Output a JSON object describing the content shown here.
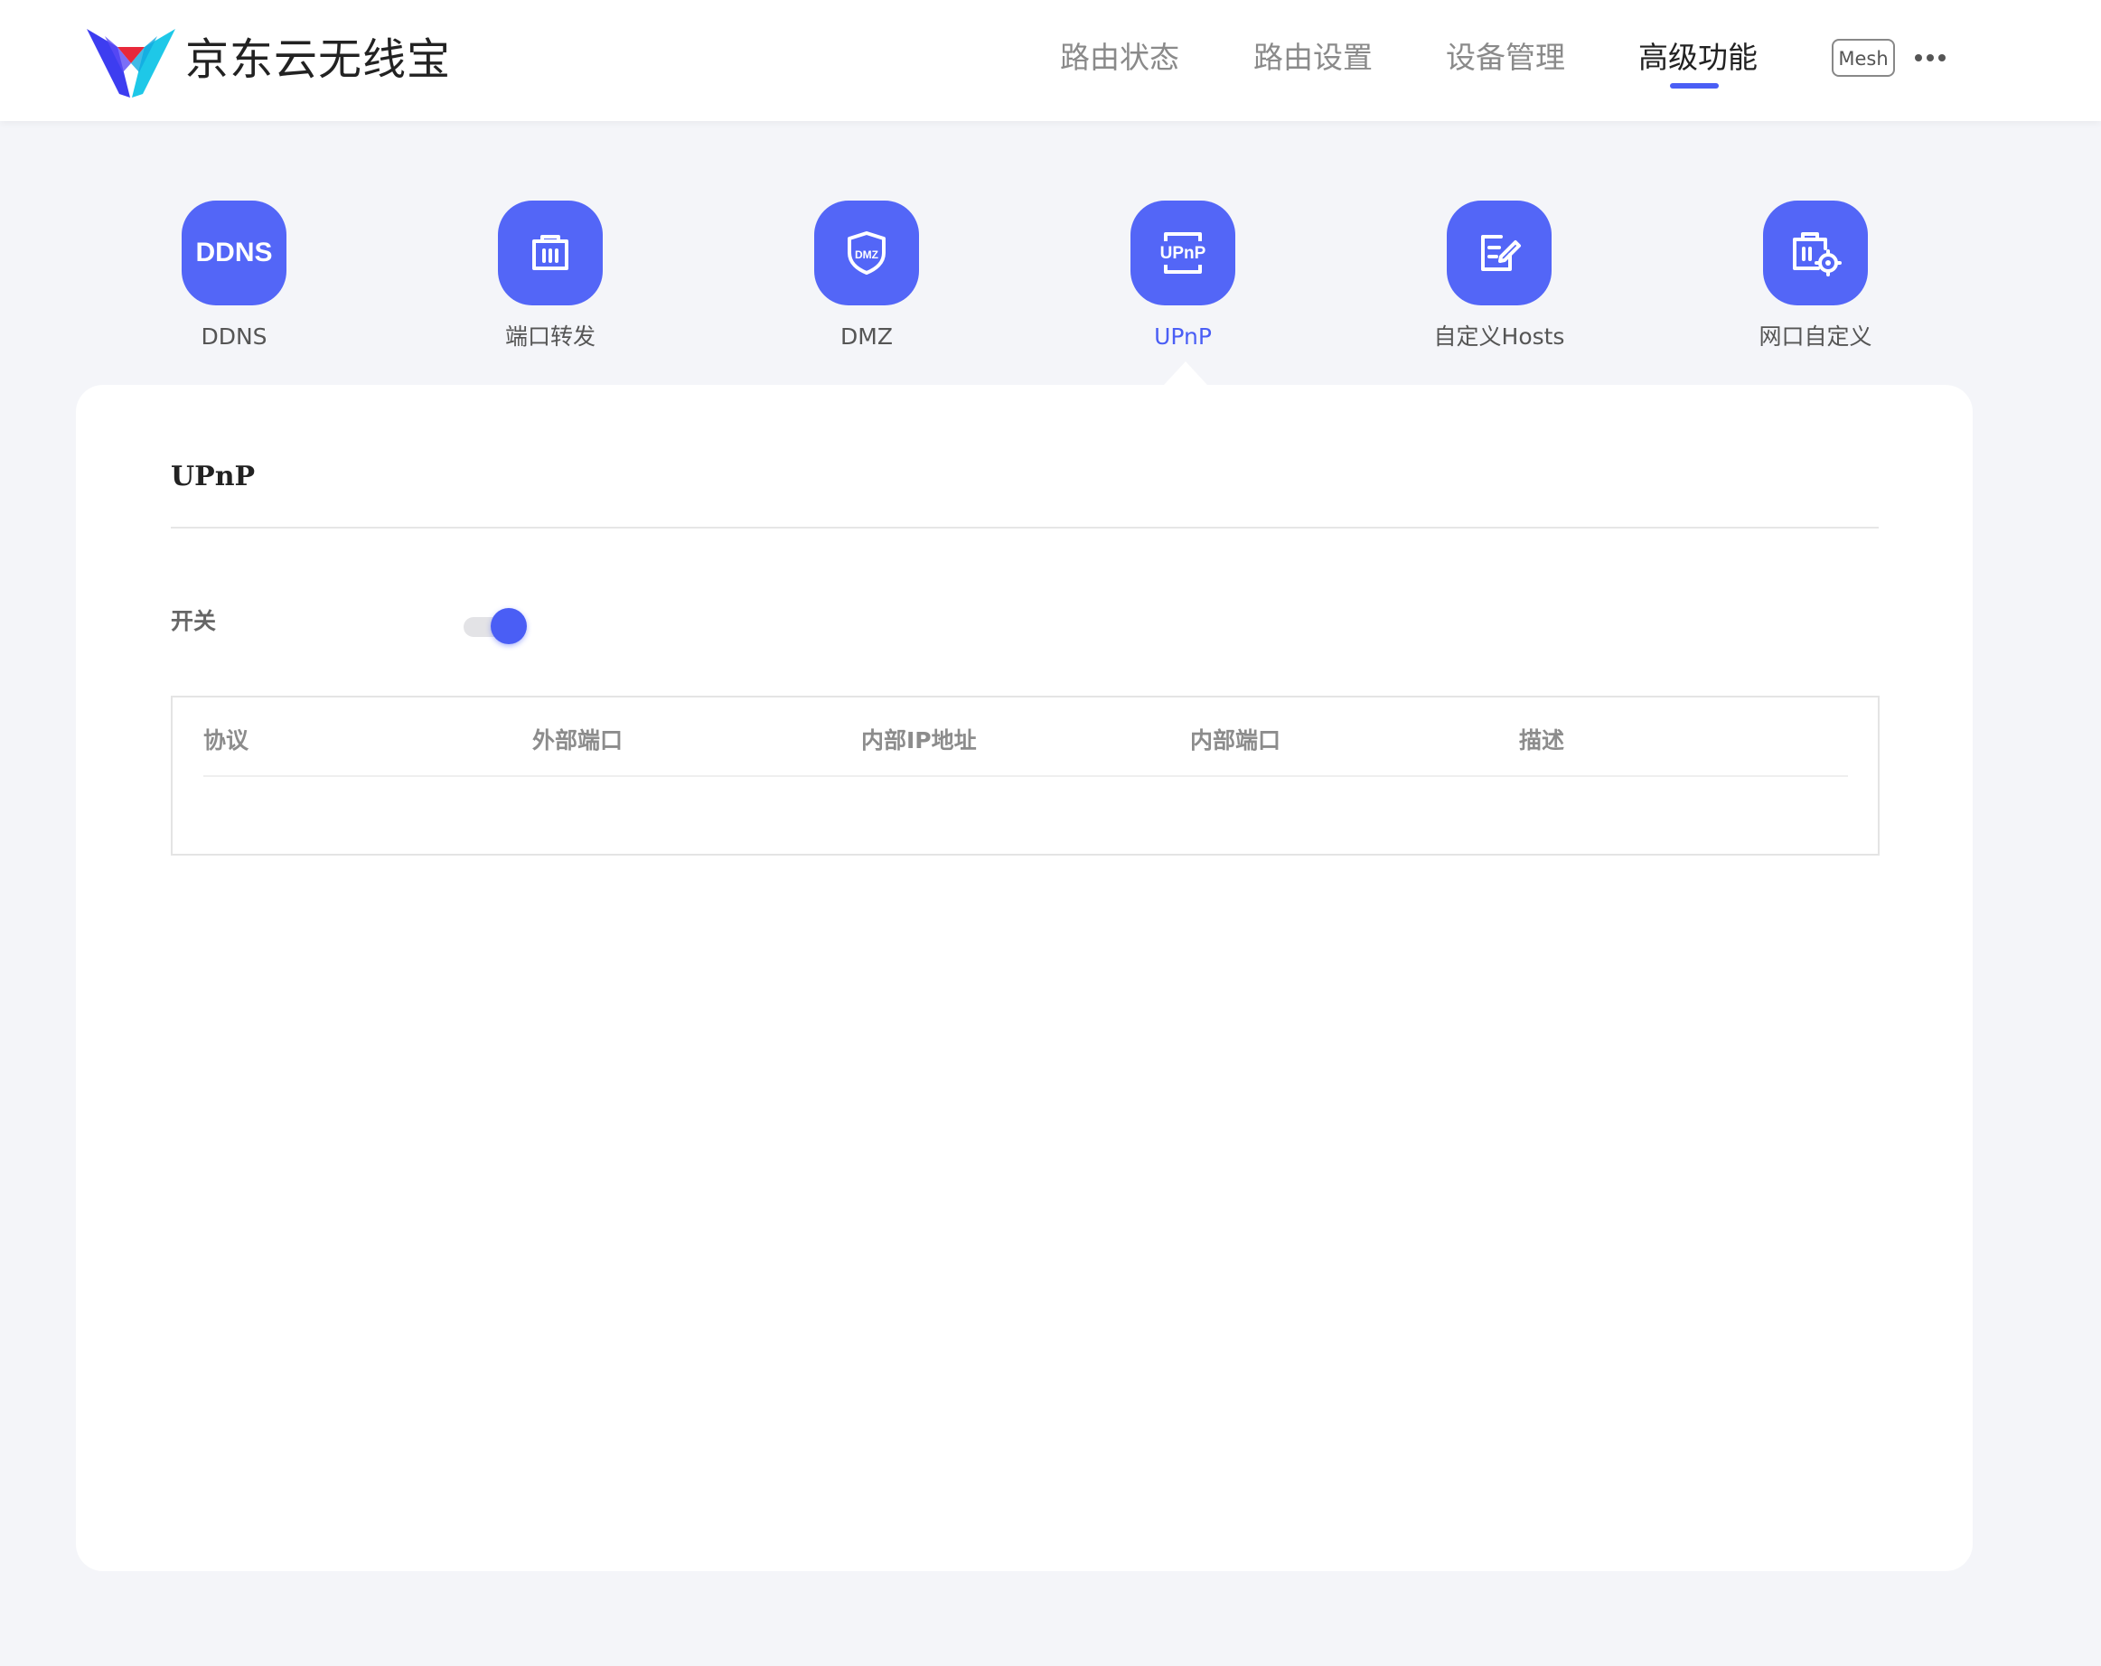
{
  "header": {
    "brand": "京东云无线宝",
    "nav": [
      {
        "label": "路由状态",
        "active": false
      },
      {
        "label": "路由设置",
        "active": false
      },
      {
        "label": "设备管理",
        "active": false
      },
      {
        "label": "高级功能",
        "active": true
      }
    ],
    "mesh_label": "Mesh",
    "more_icon": "ellipsis-icon"
  },
  "features": [
    {
      "label": "DDNS",
      "icon": "ddns-icon",
      "icon_text": "DDNS",
      "active": false
    },
    {
      "label": "端口转发",
      "icon": "port-forward-icon",
      "active": false
    },
    {
      "label": "DMZ",
      "icon": "dmz-shield-icon",
      "icon_text": "DMZ",
      "active": false
    },
    {
      "label": "UPnP",
      "icon": "upnp-icon",
      "icon_text": "UPnP",
      "active": true
    },
    {
      "label": "自定义Hosts",
      "icon": "edit-hosts-icon",
      "active": false
    },
    {
      "label": "网口自定义",
      "icon": "port-settings-icon",
      "active": false
    }
  ],
  "panel": {
    "title": "UPnP",
    "switch_label": "开关",
    "switch_on": true,
    "table": {
      "columns": [
        "协议",
        "外部端口",
        "内部IP地址",
        "内部端口",
        "描述"
      ],
      "rows": []
    }
  },
  "colors": {
    "accent": "#4a5ef5",
    "tile": "#5366f7",
    "page_bg": "#f4f5f9"
  }
}
